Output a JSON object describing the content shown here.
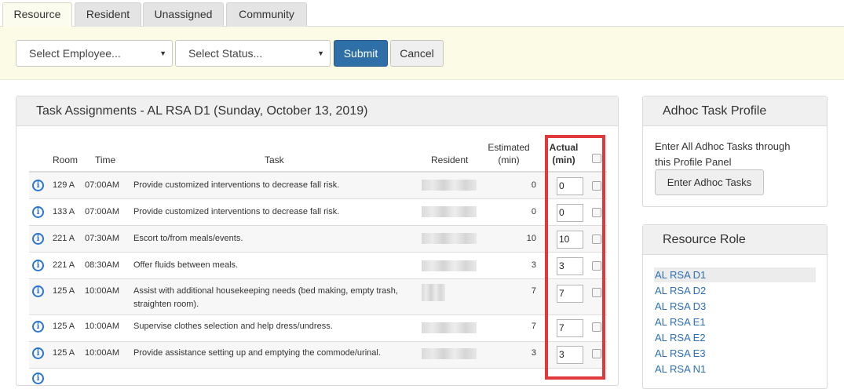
{
  "tabs": [
    {
      "label": "Resource",
      "active": true
    },
    {
      "label": "Resident",
      "active": false
    },
    {
      "label": "Unassigned",
      "active": false
    },
    {
      "label": "Community",
      "active": false
    }
  ],
  "filters": {
    "employee_select": "Select Employee...",
    "status_select": "Select Status...",
    "submit_label": "Submit",
    "cancel_label": "Cancel"
  },
  "tasks_panel": {
    "title": "Task Assignments - AL RSA D1 (Sunday, October 13, 2019)",
    "columns": {
      "room": "Room",
      "time": "Time",
      "task": "Task",
      "resident": "Resident",
      "estimated_line1": "Estimated",
      "estimated_line2": "(min)",
      "actual_line1": "Actual",
      "actual_line2": "(min)"
    },
    "rows": [
      {
        "room": "129 A",
        "time": "07:00AM",
        "task": "Provide customized interventions to decrease fall risk.",
        "estimated": "0",
        "actual": "0"
      },
      {
        "room": "133 A",
        "time": "07:00AM",
        "task": "Provide customized interventions to decrease fall risk.",
        "estimated": "0",
        "actual": "0"
      },
      {
        "room": "221 A",
        "time": "07:30AM",
        "task": "Escort to/from meals/events.",
        "estimated": "10",
        "actual": "10"
      },
      {
        "room": "221 A",
        "time": "08:30AM",
        "task": "Offer fluids between meals.",
        "estimated": "3",
        "actual": "3"
      },
      {
        "room": "125 A",
        "time": "10:00AM",
        "task_line1": "Assist with additional housekeeping needs (bed making, empty trash,",
        "task_line2": "straighten room).",
        "estimated": "7",
        "actual": "7"
      },
      {
        "room": "125 A",
        "time": "10:00AM",
        "task": "Supervise clothes selection and help dress/undress.",
        "estimated": "7",
        "actual": "7"
      },
      {
        "room": "125 A",
        "time": "10:00AM",
        "task": "Provide assistance setting up and emptying the commode/urinal.",
        "estimated": "3",
        "actual": "3"
      }
    ]
  },
  "adhoc_panel": {
    "title": "Adhoc Task Profile",
    "text_line1": "Enter All Adhoc Tasks through",
    "text_line2": "this Profile Panel",
    "button_label": "Enter Adhoc Tasks"
  },
  "resource_role_panel": {
    "title": "Resource Role",
    "roles": [
      "AL RSA D1",
      "AL RSA D2",
      "AL RSA D3",
      "AL RSA E1",
      "AL RSA E2",
      "AL RSA E3",
      "AL RSA N1"
    ],
    "selected": "AL RSA D1"
  },
  "icons": {
    "info": "info-circle-icon",
    "caret": "caret-down-icon"
  },
  "colors": {
    "primary": "#2d6fa6",
    "highlight": "#e0393b",
    "link": "#2d6fb8",
    "info": "#2b74d4"
  }
}
